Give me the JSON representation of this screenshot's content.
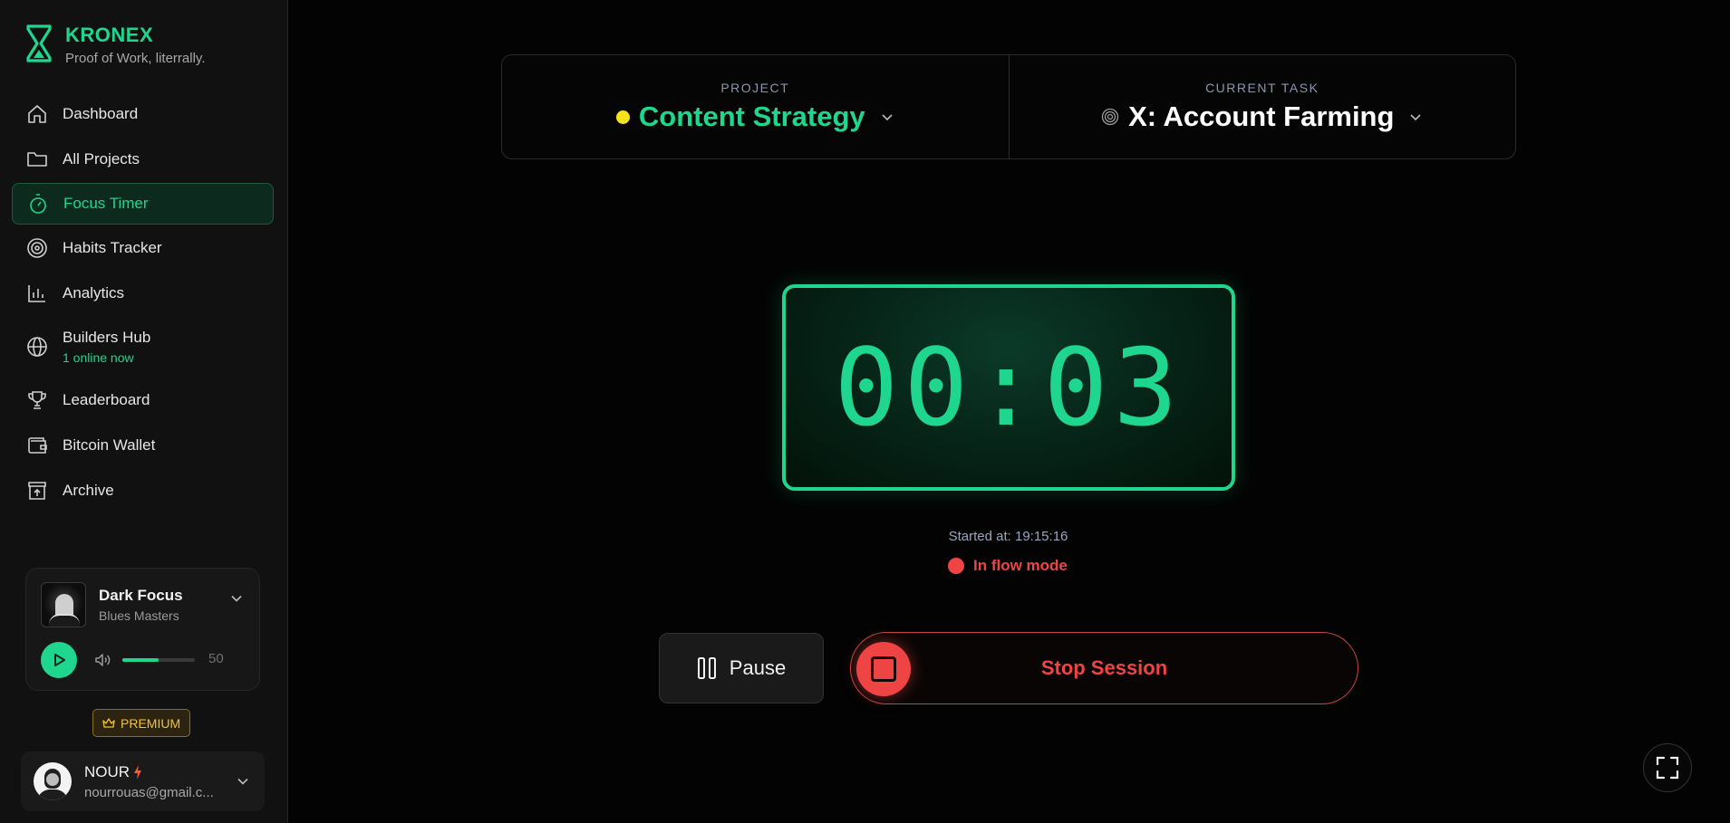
{
  "brand": {
    "name": "KRONEX",
    "tagline": "Proof of Work, literrally."
  },
  "nav": {
    "items": [
      {
        "label": "Dashboard",
        "icon": "home-icon"
      },
      {
        "label": "All Projects",
        "icon": "folder-icon"
      },
      {
        "label": "Focus Timer",
        "icon": "stopwatch-icon",
        "active": true
      },
      {
        "label": "Habits Tracker",
        "icon": "target-icon"
      },
      {
        "label": "Analytics",
        "icon": "bar-chart-icon"
      },
      {
        "label": "Builders Hub",
        "icon": "globe-icon",
        "sub": "1 online now"
      },
      {
        "label": "Leaderboard",
        "icon": "trophy-icon"
      },
      {
        "label": "Bitcoin Wallet",
        "icon": "wallet-icon"
      },
      {
        "label": "Archive",
        "icon": "archive-icon"
      }
    ]
  },
  "player": {
    "title": "Dark Focus",
    "artist": "Blues Masters",
    "volume": 50,
    "volume_fraction": 0.5
  },
  "premium": {
    "label": "PREMIUM"
  },
  "user": {
    "name": "NOUR",
    "email": "nourrouas@gmail.c..."
  },
  "session": {
    "project_caption": "PROJECT",
    "project_name": "Content Strategy",
    "project_color": "#f5e21a",
    "task_caption": "CURRENT TASK",
    "task_name": "X: Account Farming",
    "timer": "00:03",
    "started_at": "Started at: 19:15:16",
    "status": "In flow mode",
    "pause_label": "Pause",
    "stop_label": "Stop Session"
  },
  "colors": {
    "accent": "#1fd68f",
    "danger": "#ef4444",
    "premium": "#f2c230"
  }
}
